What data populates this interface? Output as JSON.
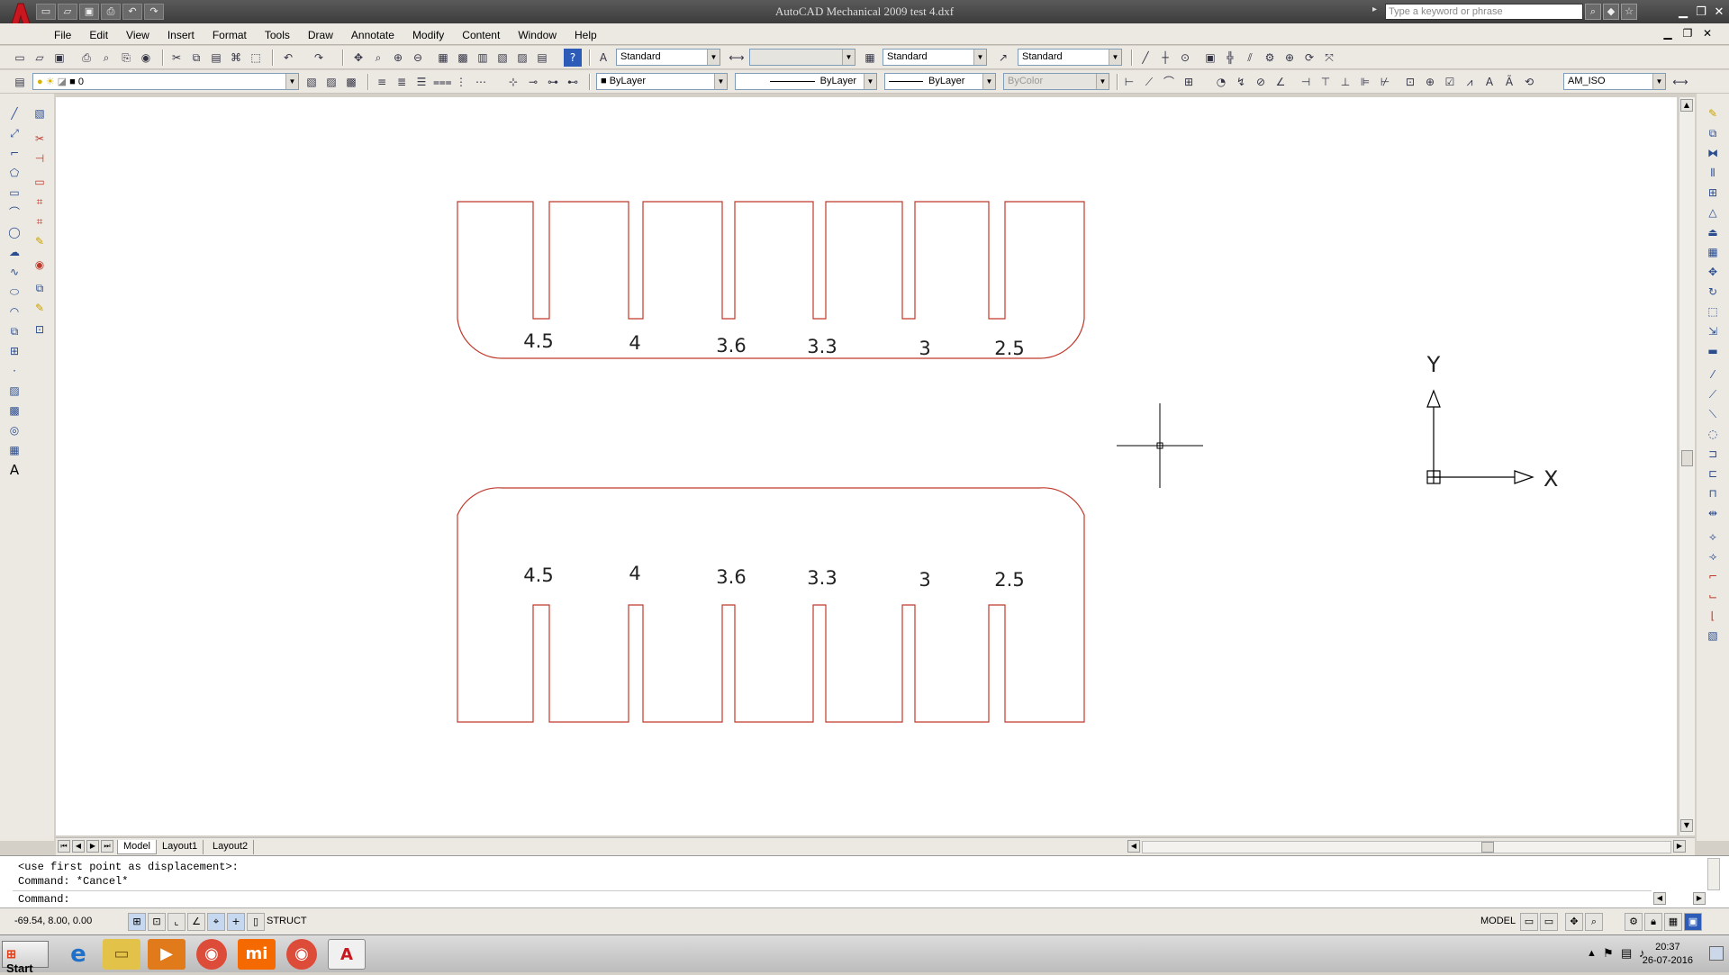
{
  "window": {
    "title": "AutoCAD Mechanical 2009 test 4.dxf",
    "search_placeholder": "Type a keyword or phrase"
  },
  "menu": [
    "File",
    "Edit",
    "View",
    "Insert",
    "Format",
    "Tools",
    "Draw",
    "Annotate",
    "Modify",
    "Content",
    "Window",
    "Help"
  ],
  "toolbar1": {
    "text_style": "Standard",
    "dim_style": "",
    "table_style": "Standard",
    "mleader_style": "Standard"
  },
  "toolbar2": {
    "layer": "0",
    "color": "ByLayer",
    "linetype": "ByLayer",
    "lineweight": "ByLayer",
    "plotstyle": "ByColor",
    "standard": "AM_ISO"
  },
  "drawing": {
    "line_color": "#c0392b",
    "top_labels": [
      "4.5",
      "4",
      "3.6",
      "3.3",
      "3",
      "2.5"
    ],
    "bottom_labels": [
      "4.5",
      "4",
      "3.6",
      "3.3",
      "3",
      "2.5"
    ],
    "ucs": {
      "x_label": "X",
      "y_label": "Y"
    }
  },
  "tabs": [
    "Model",
    "Layout1",
    "Layout2"
  ],
  "command": {
    "history": [
      "<use first point as displacement>:",
      "Command: *Cancel*"
    ],
    "prompt": "Command:"
  },
  "status": {
    "coords": "-69.54, 8.00, 0.00",
    "struct_label": "STRUCT",
    "model_label": "MODEL"
  },
  "taskbar": {
    "start_label": "Start",
    "time": "20:37",
    "date": "26-07-2016"
  }
}
